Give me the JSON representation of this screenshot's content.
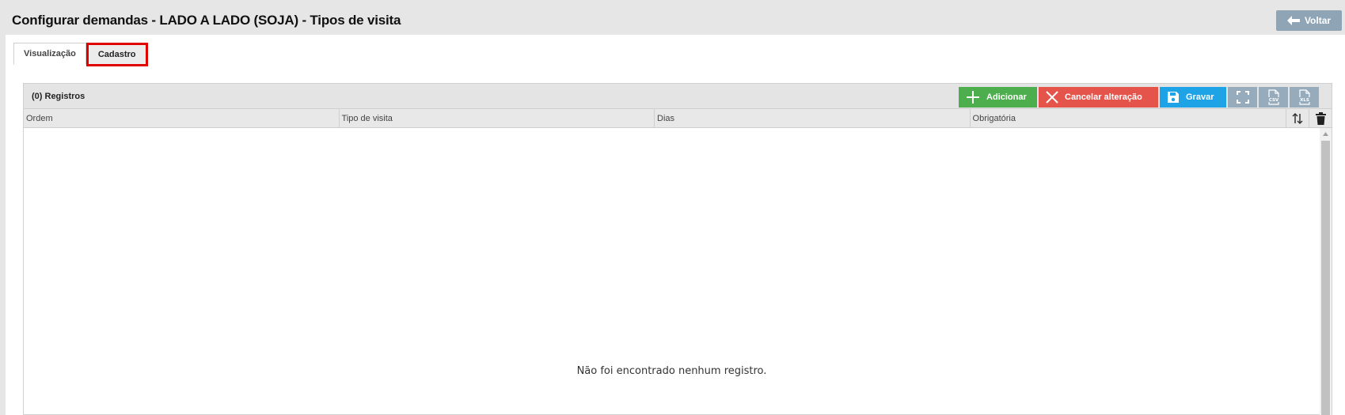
{
  "header": {
    "title": "Configurar demandas - LADO A LADO (SOJA) - Tipos de visita",
    "back_label": "Voltar"
  },
  "tabs": [
    {
      "label": "Visualização",
      "active": true
    },
    {
      "label": "Cadastro",
      "active": false,
      "highlighted": true
    }
  ],
  "grid": {
    "record_count": "(0) Registros",
    "buttons": {
      "add_label": "Adicionar",
      "cancel_label": "Cancelar alteração",
      "save_label": "Gravar",
      "fullscreen_icon": "fullscreen-icon",
      "csv_icon": "csv-export-icon",
      "xls_icon": "xls-export-icon"
    },
    "columns": [
      "Ordem",
      "Tipo de visita",
      "Dias",
      "Obrigatória"
    ],
    "sort_icon": "sort-icon",
    "delete_icon": "trash-icon",
    "empty_message": "Não foi encontrado nenhum registro."
  },
  "colors": {
    "add": "#4cae4c",
    "cancel": "#e5544b",
    "save": "#1ea4e6",
    "neutral": "#96acbd",
    "highlight": "#e00000"
  }
}
